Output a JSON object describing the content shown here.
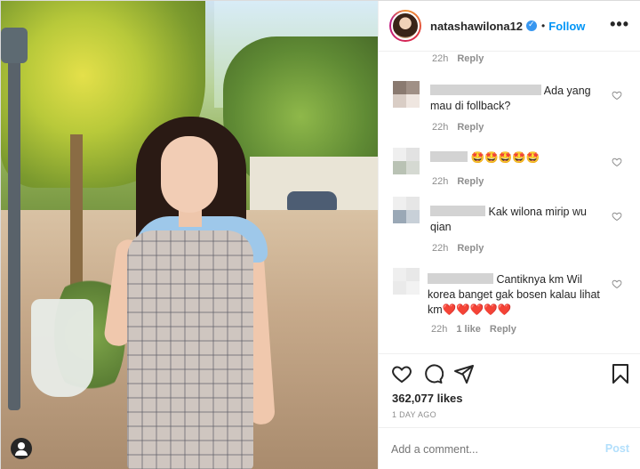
{
  "post": {
    "username": "natashawilona12",
    "dot": "•",
    "follow_label": "Follow",
    "more_label": "•••"
  },
  "comments": [
    {
      "time": "22h",
      "reply": "Reply"
    },
    {
      "text": "Ada yang mau di follback?",
      "time": "22h",
      "reply": "Reply"
    },
    {
      "text": "🤩🤩🤩🤩🤩",
      "time": "22h",
      "reply": "Reply"
    },
    {
      "text": "Kak wilona mirip wu qian",
      "time": "22h",
      "reply": "Reply"
    },
    {
      "text": "Cantiknya km Wil korea banget gak bosen kalau lihat km❤️❤️❤️❤️❤️",
      "time": "22h",
      "likes": "1 like",
      "reply": "Reply"
    }
  ],
  "footer": {
    "likes": "362,077 likes",
    "date": "1 DAY AGO",
    "comment_placeholder": "Add a comment...",
    "post_label": "Post"
  },
  "icons": {
    "like": "heart-icon",
    "comment": "comment-icon",
    "share": "share-icon",
    "save": "bookmark-icon",
    "user_tag": "user-tag-icon",
    "verified": "verified-badge-icon"
  },
  "colors": {
    "link": "#0095f6",
    "post_disabled": "#b2dffc",
    "muted": "#8e8e8e",
    "text": "#262626"
  }
}
